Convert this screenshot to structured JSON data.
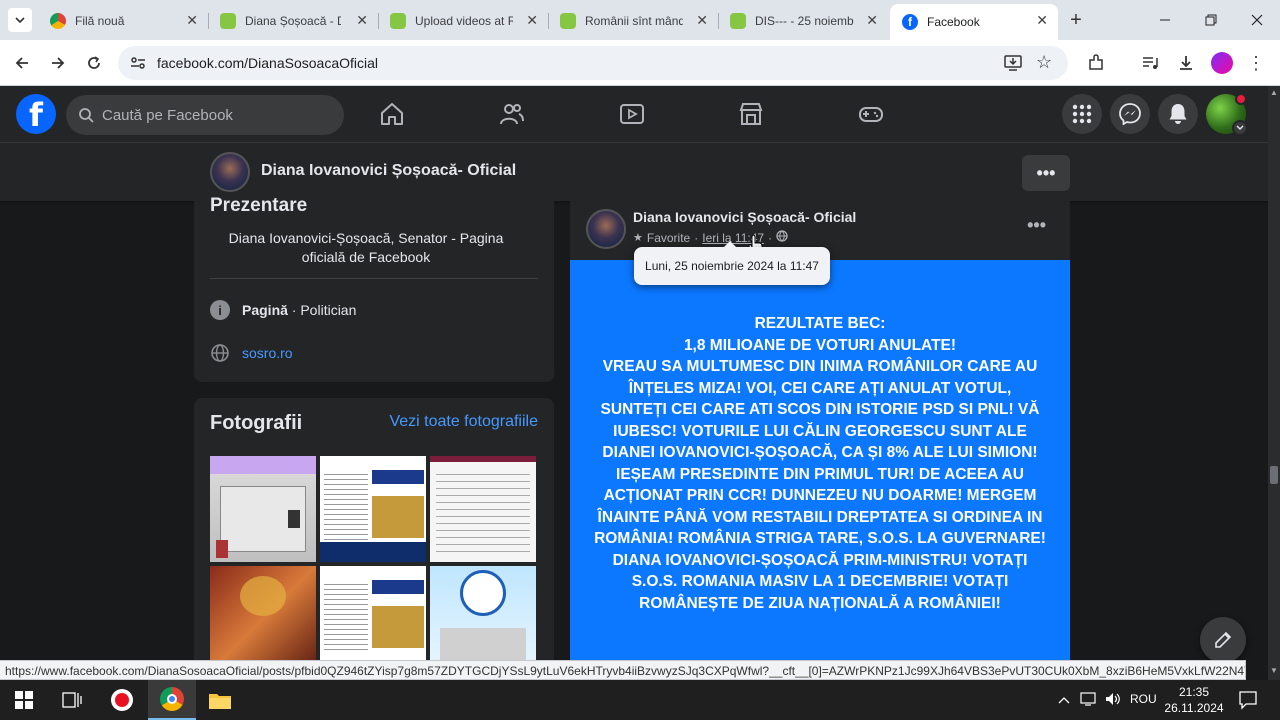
{
  "browser": {
    "tabs": [
      {
        "title": "Filă nouă",
        "icon": "chrome-icon",
        "active": false
      },
      {
        "title": "Diana Șoșoacă - D",
        "icon": "rumble-icon",
        "active": false
      },
      {
        "title": "Upload videos at R",
        "icon": "rumble-icon",
        "active": false
      },
      {
        "title": "Românii sînt mând",
        "icon": "rumble-icon",
        "active": false
      },
      {
        "title": "DIS--- - 25 noiemb",
        "icon": "rumble-icon",
        "active": false
      },
      {
        "title": "Facebook",
        "icon": "facebook-icon",
        "active": true
      }
    ],
    "url": "facebook.com/DianaSosoacaOficial"
  },
  "facebook": {
    "search_placeholder": "Caută pe Facebook",
    "page_name": "Diana Iovanovici Șoșoacă- Oficial"
  },
  "intro": {
    "title": "Prezentare",
    "description": "Diana Iovanovici-Șoșoacă, Senator - Pagina oficială de Facebook",
    "category_bold": "Pagină",
    "category_rest": " · Politician",
    "website": "sosro.ro"
  },
  "photos": {
    "title": "Fotografii",
    "see_all": "Vezi toate fotografiile"
  },
  "post": {
    "author": "Diana Iovanovici Șoșoacă- Oficial",
    "audience": "Favorite",
    "time": "Ieri la 11:47",
    "tooltip": "Luni, 25 noiembrie 2024 la 11:47",
    "text": "REZULTATE BEC:\n1,8 MILIOANE DE VOTURI ANULATE!\nVREAU SA MULTUMESC DIN INIMA ROMÂNILOR CARE AU ÎNȚELES MIZA! VOI, CEI CARE AȚI ANULAT VOTUL, SUNTEȚI CEI CARE ATI SCOS DIN ISTORIE PSD SI PNL! VĂ IUBESC! VOTURILE LUI CĂLIN GEORGESCU SUNT ALE DIANEI IOVANOVICI-ȘOȘOACĂ, CA ȘI 8% ALE LUI SIMION! IEȘEAM PRESEDINTE DIN PRIMUL TUR! DE ACEEA AU ACȚIONAT PRIN CCR! DUNNEZEU NU DOARME! MERGEM ÎNAINTE PÂNĂ VOM RESTABILI DREPTATEA SI ORDINEA IN ROMÂNIA! ROMÂNIA STRIGA TARE, S.O.S. LA GUVERNARE! DIANA IOVANOVICI-ȘOȘOACĂ PRIM-MINISTRU! VOTAȚI S.O.S. ROMANIA MASIV LA 1 DECEMBRIE! VOTAȚI ROMÂNEȘTE DE ZIUA NAȚIONALĂ A ROMÂNIEI!"
  },
  "status_url": "https://www.facebook.com/DianaSosoacaOficial/posts/pfbid0QZ946tZYisp7g8m57ZDYTGCDjYSsL9ytLuV6ekHTryvb4iiBzvwyzSJq3CXPqWfwl?__cft__[0]=AZWrPKNPz1Jc99XJh64VBS3ePvUT30CUk0XbM_8xziB6HeM5VxkLfW22N4TFd_Q...",
  "taskbar": {
    "lang": "ROU",
    "time": "21:35",
    "date": "26.11.2024"
  },
  "colors": {
    "fb_blue": "#0866ff",
    "post_bg": "#0b78ff",
    "dark_bg": "#18191a",
    "card_bg": "#242526"
  }
}
